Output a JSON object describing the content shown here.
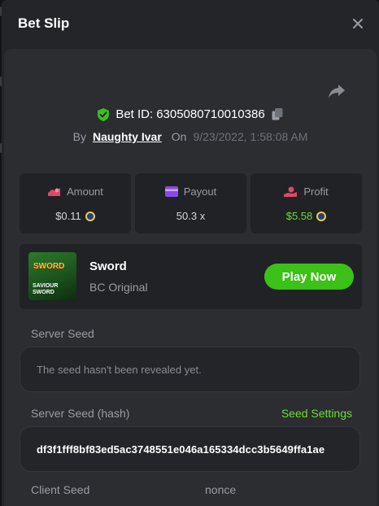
{
  "modal": {
    "title": "Bet Slip"
  },
  "bet": {
    "id_label": "Bet ID:",
    "id_value": "6305080710010386",
    "by_label": "By",
    "user": "Naughty Ivar",
    "on_label": "On",
    "date": "9/23/2022, 1:58:08 AM"
  },
  "stats": {
    "amount": {
      "label": "Amount",
      "value": "$0.11",
      "icon_color": "#e0476a"
    },
    "payout": {
      "label": "Payout",
      "value": "50.3 x",
      "icon_color": "#8c47e8"
    },
    "profit": {
      "label": "Profit",
      "value": "$5.58",
      "icon_color": "#e0476a",
      "value_color": "#6ddd2a"
    }
  },
  "game": {
    "name": "Sword",
    "provider": "BC Original",
    "play_label": "Play Now",
    "thumb_title": "SWORD",
    "thumb_sub": "SAVIOUR SWORD"
  },
  "seeds": {
    "server_seed_label": "Server Seed",
    "server_seed_value": "The seed hasn't been revealed yet.",
    "server_hash_label": "Server Seed (hash)",
    "seed_settings_label": "Seed Settings",
    "server_hash_value": "df3f1fff8bf83ed5ac3748551e046a165334dcc3b5649ffa1ae",
    "client_seed_label": "Client Seed",
    "nonce_label": "nonce"
  },
  "colors": {
    "accent_green": "#3bc117",
    "text_green": "#6ddd2a",
    "coin_gold": "#f3c94a",
    "coin_blue": "#1f3f86"
  },
  "icons": [
    "close-icon",
    "share-icon",
    "shield-check-icon",
    "copy-icon",
    "wallet-hand-icon",
    "card-icon",
    "money-hand-icon",
    "coin-icon"
  ]
}
